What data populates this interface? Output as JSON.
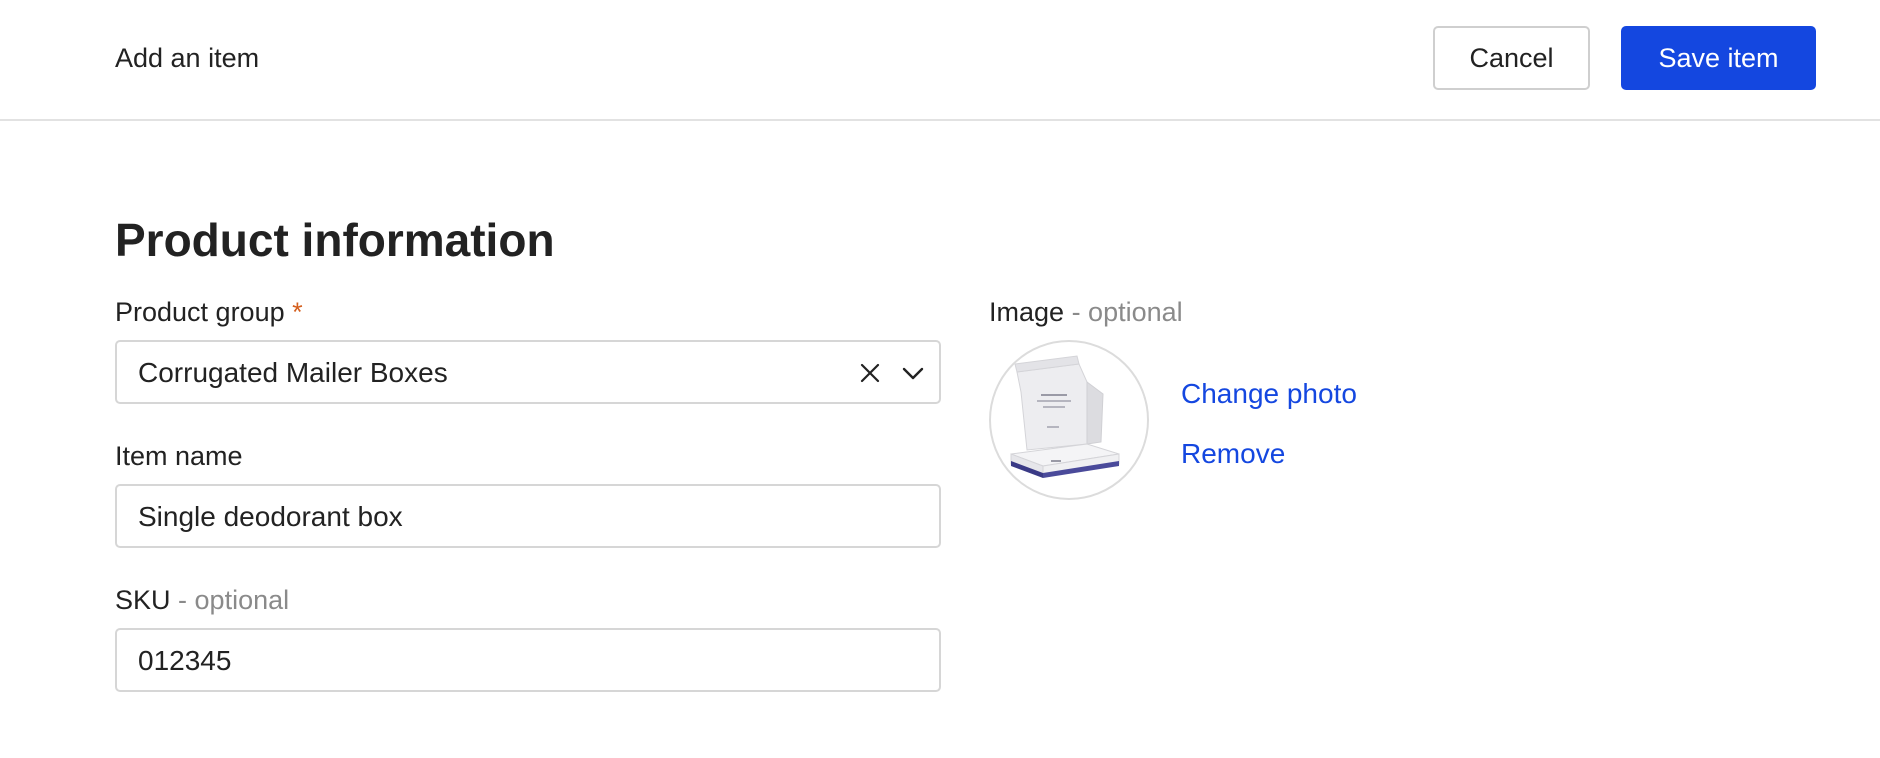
{
  "header": {
    "title": "Add an item",
    "cancel_label": "Cancel",
    "save_label": "Save item"
  },
  "section": {
    "title": "Product information"
  },
  "fields": {
    "product_group": {
      "label": "Product group",
      "required_marker": "*",
      "value": "Corrugated Mailer Boxes"
    },
    "item_name": {
      "label": "Item name",
      "value": "Single deodorant box"
    },
    "sku": {
      "label": "SKU",
      "optional_suffix": "- optional",
      "value": "012345"
    }
  },
  "image": {
    "label": "Image",
    "optional_suffix": "- optional",
    "change_label": "Change photo",
    "remove_label": "Remove"
  },
  "colors": {
    "primary": "#1447e0",
    "required": "#d45f1e",
    "muted_text": "#8a8a8a",
    "border": "#d6d6d6"
  },
  "icons": {
    "clear": "close-icon",
    "dropdown": "chevron-down-icon",
    "thumbnail": "mailer-box-image"
  }
}
